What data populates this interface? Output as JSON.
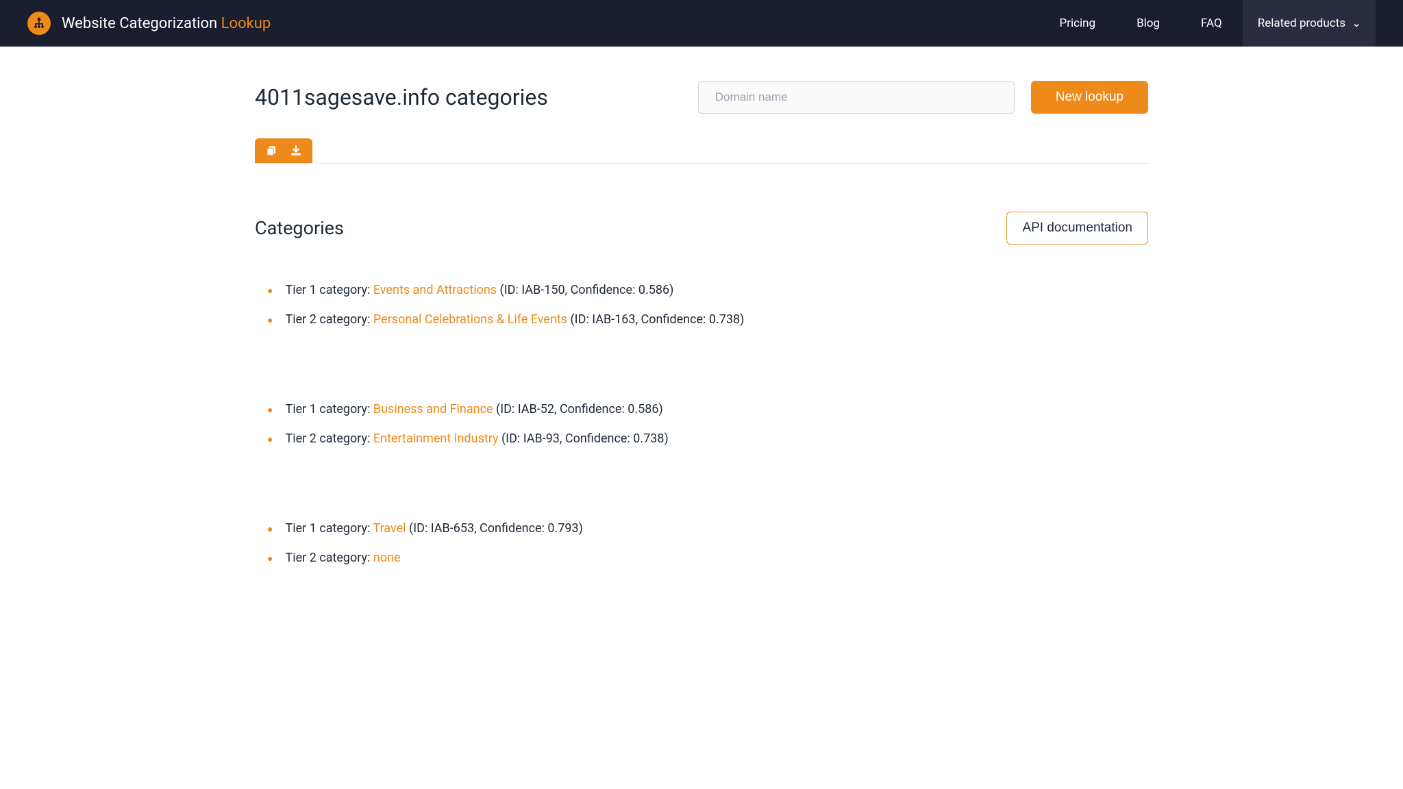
{
  "header": {
    "brand_main": "Website Categorization ",
    "brand_accent": "Lookup",
    "nav": {
      "pricing": "Pricing",
      "blog": "Blog",
      "faq": "FAQ",
      "related": "Related products"
    }
  },
  "page": {
    "title": "4011sagesave.info categories",
    "domain_placeholder": "Domain name",
    "new_lookup": "New lookup"
  },
  "categories_section": {
    "title": "Categories",
    "api_button": "API documentation"
  },
  "groups": [
    {
      "tier1_label": "Tier 1 category: ",
      "tier1_name": "Events and Attractions",
      "tier1_meta": " (ID: IAB-150, Confidence: 0.586)",
      "tier2_label": "Tier 2 category: ",
      "tier2_name": "Personal Celebrations & Life Events",
      "tier2_meta": " (ID: IAB-163, Confidence: 0.738)"
    },
    {
      "tier1_label": "Tier 1 category: ",
      "tier1_name": "Business and Finance",
      "tier1_meta": " (ID: IAB-52, Confidence: 0.586)",
      "tier2_label": "Tier 2 category: ",
      "tier2_name": "Entertainment Industry",
      "tier2_meta": " (ID: IAB-93, Confidence: 0.738)"
    },
    {
      "tier1_label": "Tier 1 category: ",
      "tier1_name": "Travel",
      "tier1_meta": " (ID: IAB-653, Confidence: 0.793)",
      "tier2_label": "Tier 2 category: ",
      "tier2_name": "none",
      "tier2_meta": ""
    }
  ]
}
